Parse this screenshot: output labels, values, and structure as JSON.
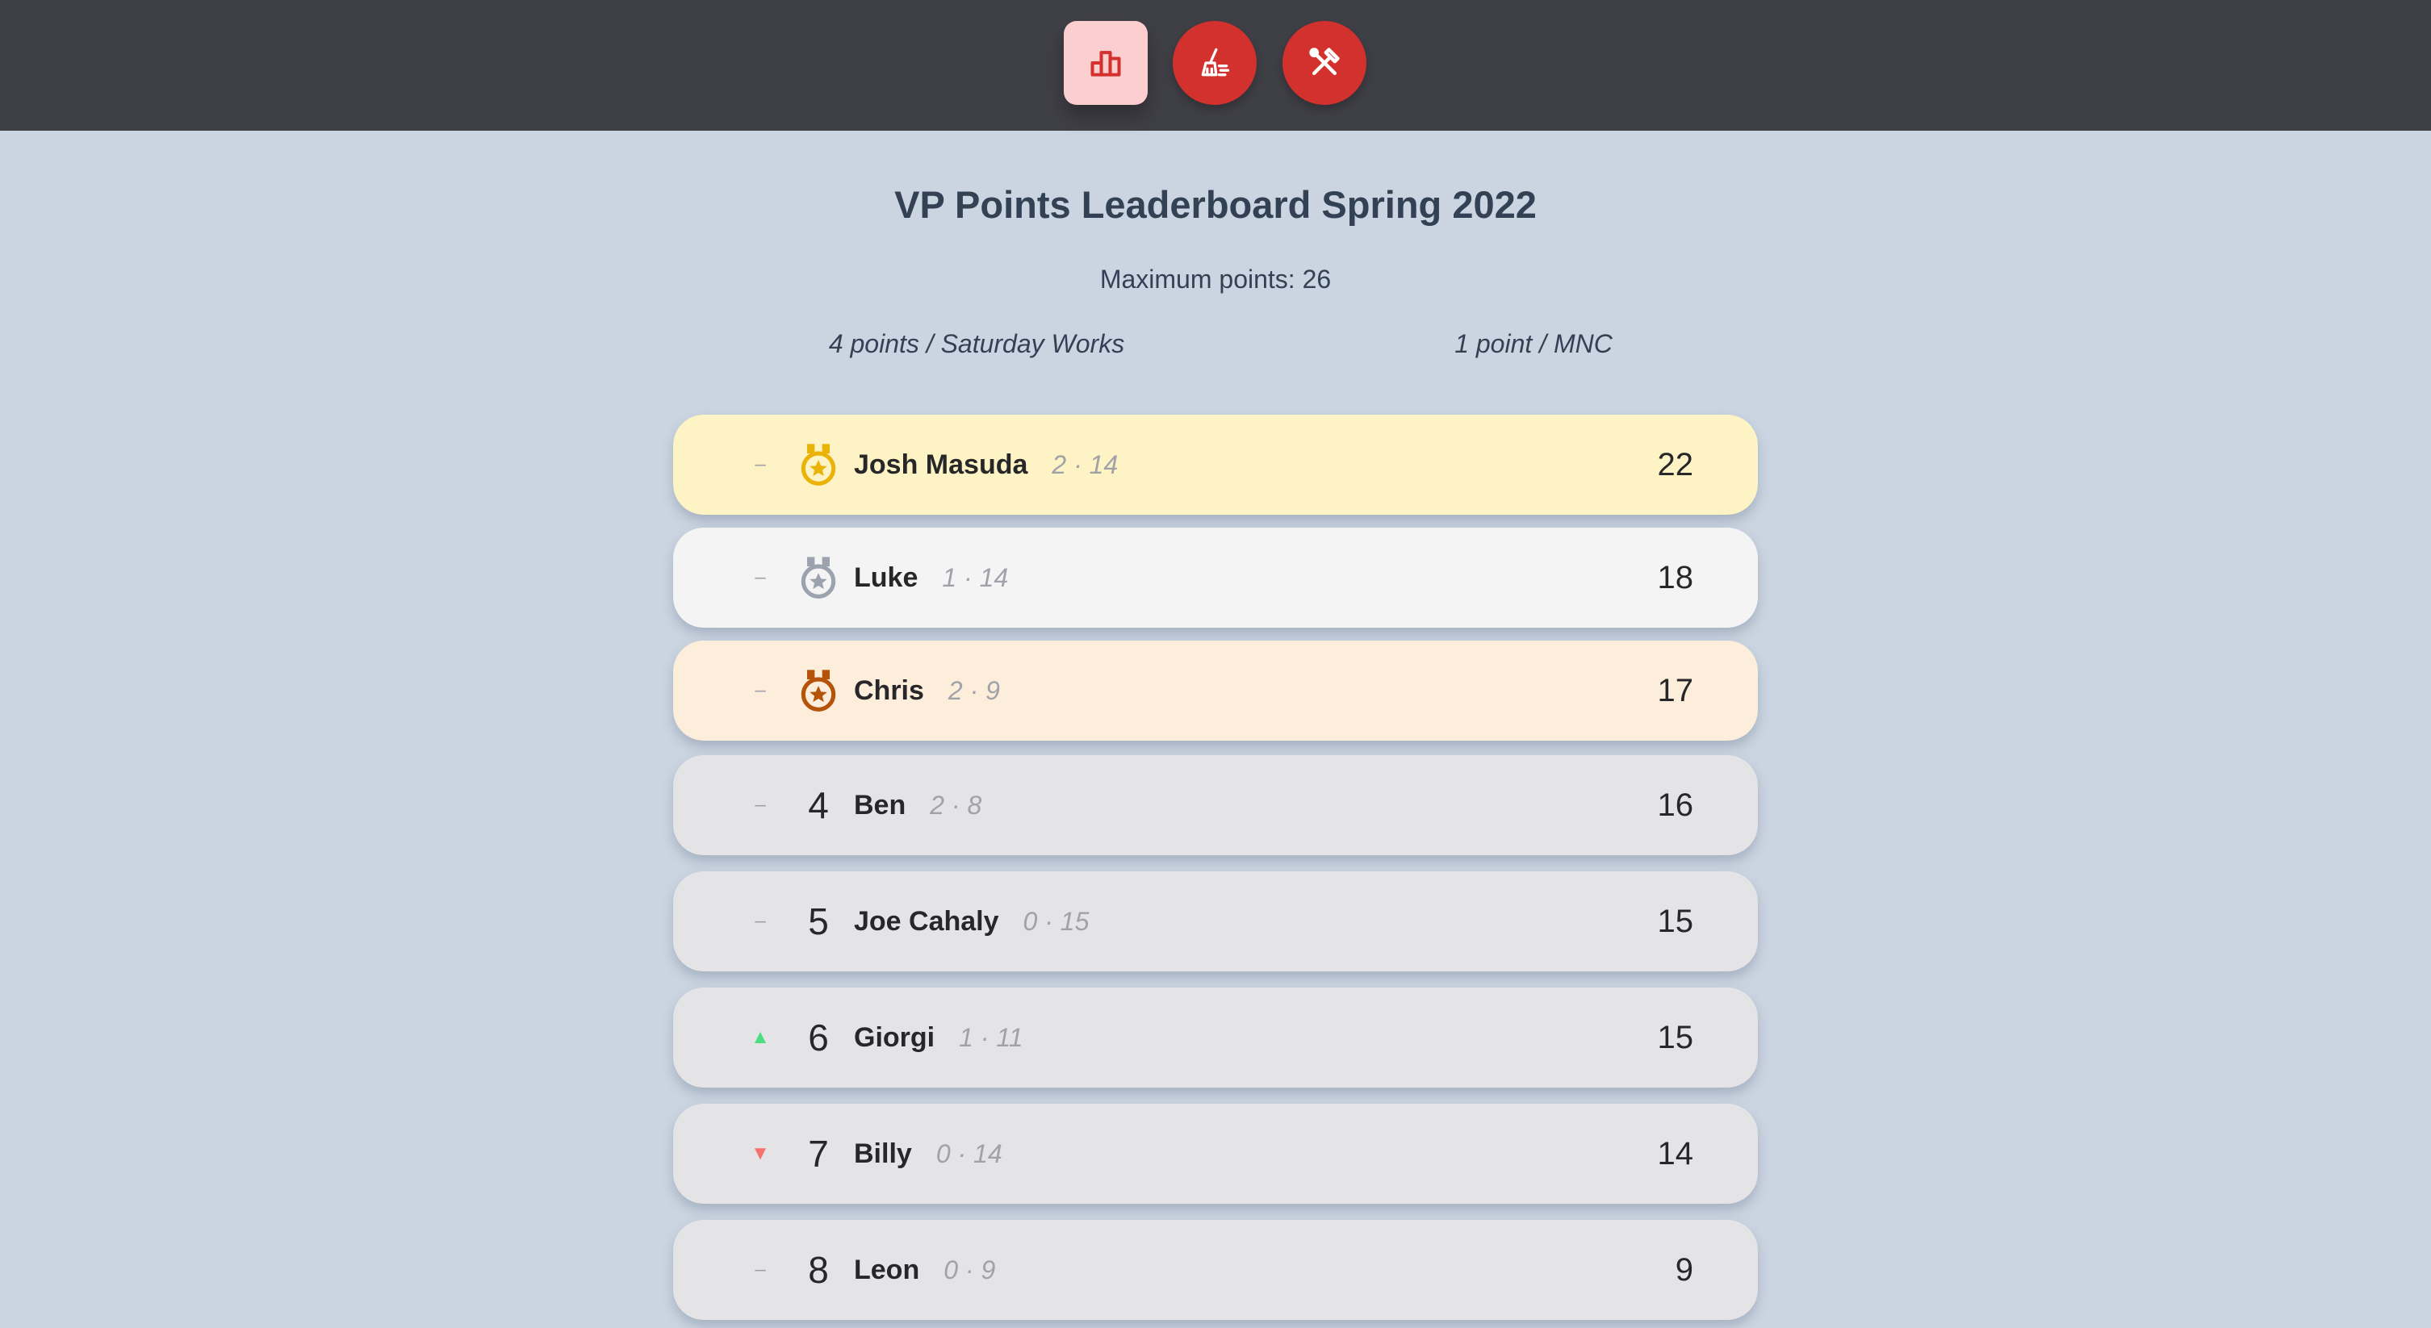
{
  "nav": {
    "buttons": [
      {
        "icon": "leaderboard-icon",
        "active": true
      },
      {
        "icon": "broom-icon",
        "active": false
      },
      {
        "icon": "tools-icon",
        "active": false
      }
    ],
    "colors": {
      "bar": "#3f3f46",
      "active_bg": "#fbcfd0",
      "button_bg": "#d3312e"
    }
  },
  "header": {
    "title": "VP Points Leaderboard Spring 2022",
    "max_points": "Maximum points: 26",
    "rule_saturday": "4 points / Saturday Works",
    "rule_mnc": "1 point / MNC"
  },
  "leaderboard": [
    {
      "trend": "neutral",
      "trend_symbol": "–",
      "rank": "1",
      "medal": "gold",
      "name": "Josh Masuda",
      "detail": "2 · 14",
      "score": "22"
    },
    {
      "trend": "neutral",
      "trend_symbol": "–",
      "rank": "2",
      "medal": "silver",
      "name": "Luke",
      "detail": "1 · 14",
      "score": "18"
    },
    {
      "trend": "neutral",
      "trend_symbol": "–",
      "rank": "3",
      "medal": "bronze",
      "name": "Chris",
      "detail": "2 · 9",
      "score": "17"
    },
    {
      "trend": "neutral",
      "trend_symbol": "–",
      "rank": "4",
      "medal": "",
      "name": "Ben",
      "detail": "2 · 8",
      "score": "16"
    },
    {
      "trend": "neutral",
      "trend_symbol": "–",
      "rank": "5",
      "medal": "",
      "name": "Joe Cahaly",
      "detail": "0 · 15",
      "score": "15"
    },
    {
      "trend": "up",
      "trend_symbol": "▲",
      "rank": "6",
      "medal": "",
      "name": "Giorgi",
      "detail": "1 · 11",
      "score": "15"
    },
    {
      "trend": "down",
      "trend_symbol": "▼",
      "rank": "7",
      "medal": "",
      "name": "Billy",
      "detail": "0 · 14",
      "score": "14"
    },
    {
      "trend": "neutral",
      "trend_symbol": "–",
      "rank": "8",
      "medal": "",
      "name": "Leon",
      "detail": "0 · 9",
      "score": "9"
    }
  ],
  "medal_colors": {
    "gold": "#eab308",
    "silver": "#9ca3af",
    "bronze": "#b45309"
  }
}
